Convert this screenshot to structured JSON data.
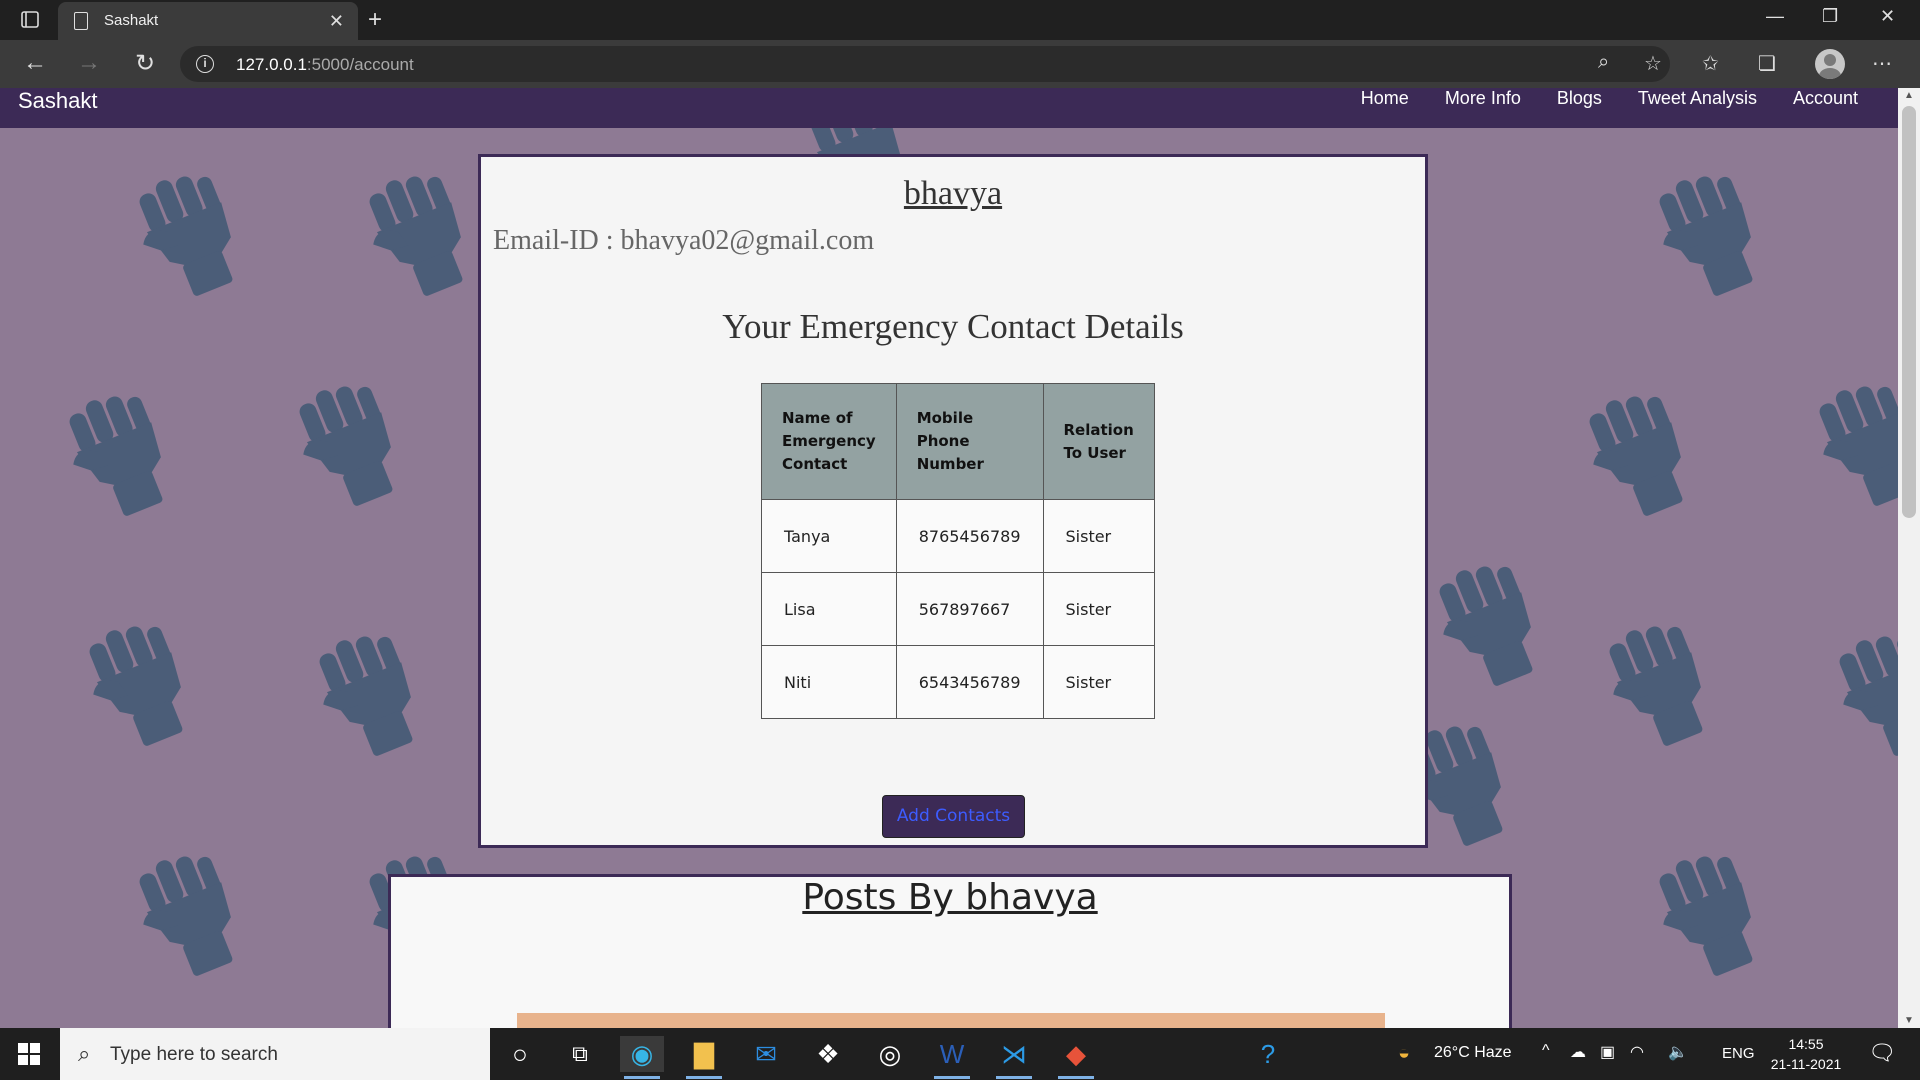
{
  "browser": {
    "tab_title": "Sashakt",
    "url_host": "127.0.0.1",
    "url_rest": ":5000/account"
  },
  "site": {
    "brand": "Sashakt",
    "nav": [
      "Home",
      "More Info",
      "Blogs",
      "Tweet Analysis",
      "Account"
    ]
  },
  "account": {
    "username": "bhavya",
    "email_line": "Email-ID : bhavya02@gmail.com",
    "section_title": "Your Emergency Contact Details",
    "table_headers": [
      "Name of Emergency Contact",
      "Mobile Phone Number",
      "Relation To User"
    ],
    "contacts": [
      {
        "name": "Tanya",
        "phone": "8765456789",
        "relation": "Sister"
      },
      {
        "name": "Lisa",
        "phone": "567897667",
        "relation": "Sister"
      },
      {
        "name": "Niti",
        "phone": "6543456789",
        "relation": "Sister"
      }
    ],
    "add_button": "Add Contacts"
  },
  "posts": {
    "title": "Posts By bhavya"
  },
  "taskbar": {
    "search_placeholder": "Type here to search",
    "weather": "26°C  Haze",
    "language": "ENG",
    "time": "14:55",
    "date": "21-11-2021"
  },
  "colors": {
    "page_bg": "#8e7a94",
    "nav_bg": "#3c2a56",
    "fist": "#4b5d78",
    "table_header_bg": "#93a2a2",
    "button_text": "#3d5cff"
  }
}
